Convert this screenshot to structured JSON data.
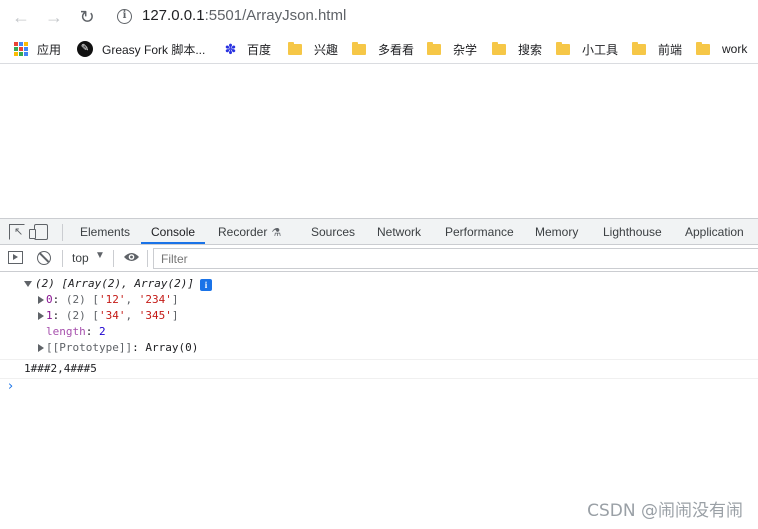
{
  "browser": {
    "url_host": "127.0.0.1",
    "url_rest": ":5501/ArrayJson.html"
  },
  "bookmarks": [
    {
      "label": "应用",
      "icon": "apps-grid-icon"
    },
    {
      "label": "Greasy Fork 脚本...",
      "icon": "greasy-fork-icon"
    },
    {
      "label": "百度",
      "icon": "baidu-paw-icon"
    },
    {
      "label": "兴趣",
      "icon": "folder-icon"
    },
    {
      "label": "多看看",
      "icon": "folder-icon"
    },
    {
      "label": "杂学",
      "icon": "folder-icon"
    },
    {
      "label": "搜索",
      "icon": "folder-icon"
    },
    {
      "label": "小工具",
      "icon": "folder-icon"
    },
    {
      "label": "前端",
      "icon": "folder-icon"
    },
    {
      "label": "work",
      "icon": "folder-icon"
    }
  ],
  "devtools": {
    "tabs": [
      "Elements",
      "Console",
      "Recorder",
      "Sources",
      "Network",
      "Performance",
      "Memory",
      "Lighthouse",
      "Application"
    ],
    "active_tab": "Console",
    "context": "top",
    "filter_placeholder": "Filter"
  },
  "console": {
    "object_summary": "(2) [Array(2), Array(2)]",
    "item0": {
      "key": "0",
      "summary_prefix": "(2) [",
      "v1": "'12'",
      "v2": "'234'"
    },
    "item1": {
      "key": "1",
      "summary_prefix": "(2) [",
      "v1": "'34'",
      "v2": "'345'"
    },
    "length_key": "length",
    "length_value": "2",
    "prototype_key": "[[Prototype]]",
    "prototype_value": "Array(0)",
    "log_output": "1###2,4###5"
  },
  "watermark": "CSDN @闹闹没有闹",
  "colors": {
    "accent": "#1a73e8",
    "string": "#c41a16",
    "number": "#1c00cf",
    "key": "#881391"
  }
}
